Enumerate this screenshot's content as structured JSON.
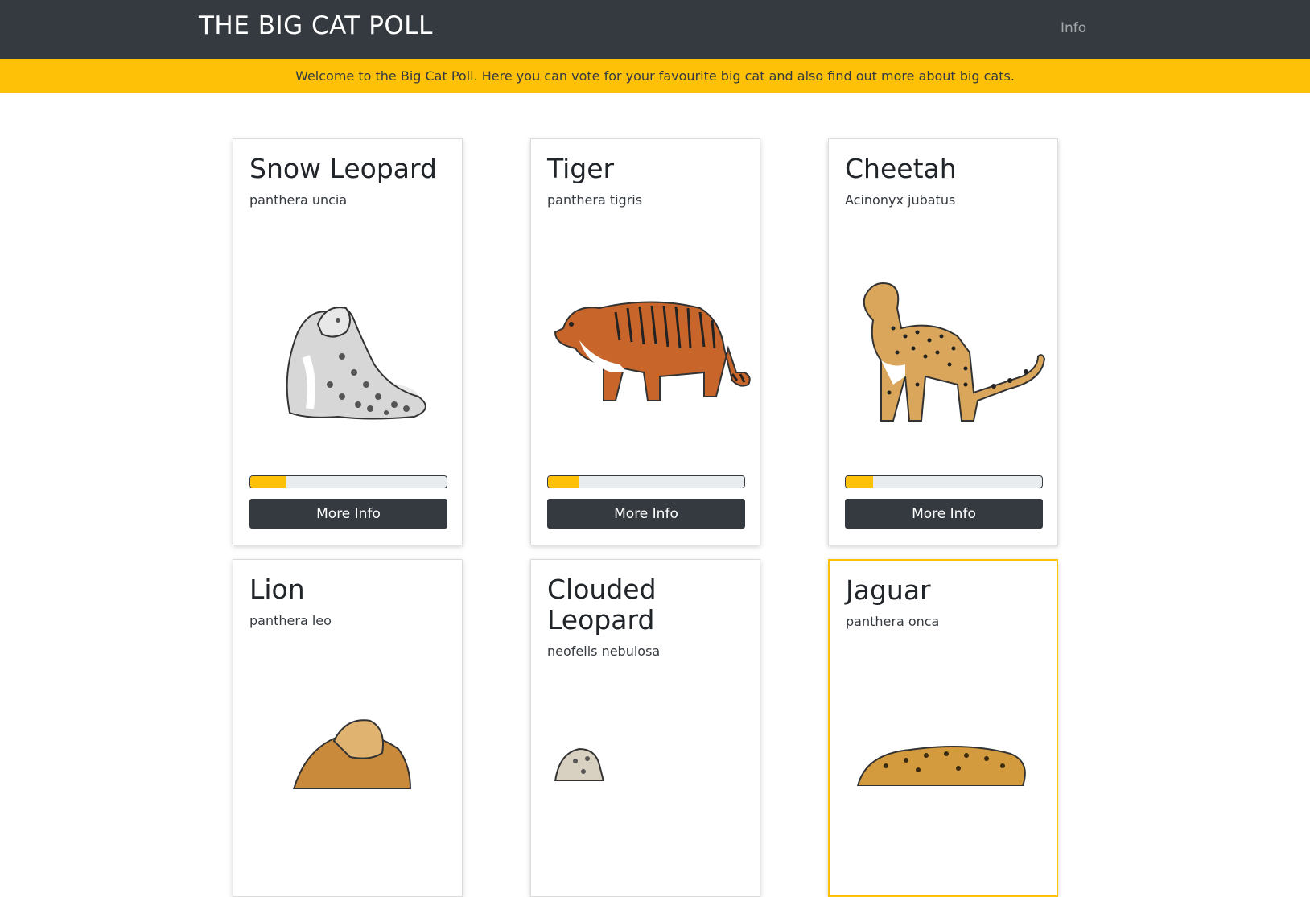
{
  "navbar": {
    "brand": "THE BIG CAT POLL",
    "info_link": "Info"
  },
  "banner": {
    "text": "Welcome to the Big Cat Poll. Here you can vote for your favourite big cat and also find out more about big cats."
  },
  "colors": {
    "dark": "#343a40",
    "accent": "#ffc107"
  },
  "cats": [
    {
      "name": "Snow Leopard",
      "latin": "panthera uncia",
      "vote_share": 0.18,
      "button": "More Info",
      "icon": "snow-leopard-illustration"
    },
    {
      "name": "Tiger",
      "latin": "panthera tigris",
      "vote_share": 0.16,
      "button": "More Info",
      "icon": "tiger-illustration"
    },
    {
      "name": "Cheetah",
      "latin": "Acinonyx jubatus",
      "vote_share": 0.14,
      "button": "More Info",
      "icon": "cheetah-illustration"
    },
    {
      "name": "Lion",
      "latin": "panthera leo",
      "icon": "lion-illustration"
    },
    {
      "name": "Clouded Leopard",
      "latin": "neofelis nebulosa",
      "icon": "clouded-leopard-illustration"
    },
    {
      "name": "Jaguar",
      "latin": "panthera onca",
      "icon": "jaguar-illustration"
    }
  ]
}
